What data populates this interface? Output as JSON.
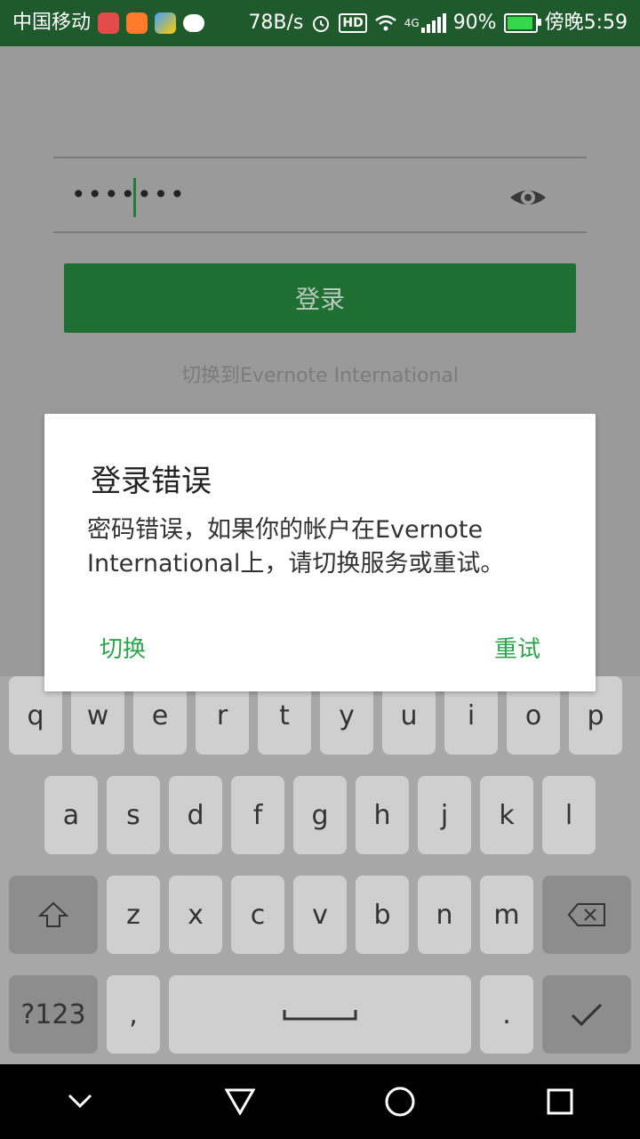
{
  "status_bar": {
    "carrier": "中国移动",
    "network_speed": "78B/s",
    "hd_label": "HD",
    "network_type": "4G",
    "battery": "90%",
    "time": "傍晚5:59",
    "colors": {
      "bar": "#1f5a2c",
      "battery_fill": "#34d84a"
    },
    "icons": [
      "app-red-icon",
      "app-orange-icon",
      "app-multicolor-icon",
      "chat-bubble-icon",
      "alarm-icon",
      "wifi-icon",
      "signal-bars-icon",
      "battery-icon"
    ]
  },
  "login": {
    "password_value": "•••••••",
    "login_button_label": "登录",
    "switch_link": "切换到Evernote International"
  },
  "dialog": {
    "title": "登录错误",
    "message": "密码错误，如果你的帐户在Evernote International上，请切换服务或重试。",
    "left_button": "切换",
    "right_button": "重试",
    "accent_color": "#2aa64a"
  },
  "keyboard": {
    "row1": [
      "q",
      "w",
      "e",
      "r",
      "t",
      "y",
      "u",
      "i",
      "o",
      "p"
    ],
    "row2": [
      "a",
      "s",
      "d",
      "f",
      "g",
      "h",
      "j",
      "k",
      "l"
    ],
    "row3": [
      "z",
      "x",
      "c",
      "v",
      "b",
      "n",
      "m"
    ],
    "bottom": {
      "symbols": "?123",
      "comma": ",",
      "period": "."
    },
    "icons": [
      "shift-icon",
      "backspace-icon",
      "space-icon",
      "enter-check-icon"
    ]
  },
  "nav_bar": {
    "icons": [
      "back-chevron-icon",
      "home-triangle-icon",
      "home-circle-icon",
      "recent-square-icon"
    ]
  }
}
